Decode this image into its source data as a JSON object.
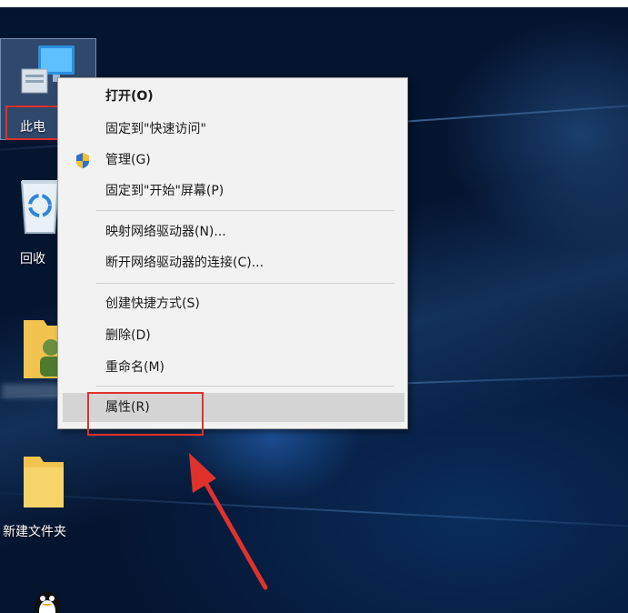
{
  "desktop": {
    "icons": [
      {
        "name": "此电脑",
        "label": "此电"
      },
      {
        "name": "回收站",
        "label": "回收"
      },
      {
        "name": "user-folder",
        "label": ""
      },
      {
        "name": "新建文件夹",
        "label": "新建文件夹"
      },
      {
        "name": "QQ",
        "label": ""
      }
    ]
  },
  "context_menu": {
    "groups": [
      {
        "items": [
          {
            "label": "打开(O)",
            "bold": true
          },
          {
            "label": "固定到\"快速访问\""
          },
          {
            "label": "管理(G)",
            "icon": "uac-shield-icon"
          },
          {
            "label": "固定到\"开始\"屏幕(P)"
          }
        ]
      },
      {
        "items": [
          {
            "label": "映射网络驱动器(N)..."
          },
          {
            "label": "断开网络驱动器的连接(C)..."
          }
        ]
      },
      {
        "items": [
          {
            "label": "创建快捷方式(S)"
          },
          {
            "label": "删除(D)"
          },
          {
            "label": "重命名(M)"
          }
        ]
      },
      {
        "items": [
          {
            "label": "属性(R)",
            "highlighted": true
          }
        ]
      }
    ]
  },
  "annotations": {
    "highlight_color": "#e0322c",
    "arrow_color": "#e0322c"
  },
  "colors": {
    "menu_background": "#f2f2f2",
    "menu_hover": "#d4d4d4",
    "desktop_background": "#041733"
  }
}
